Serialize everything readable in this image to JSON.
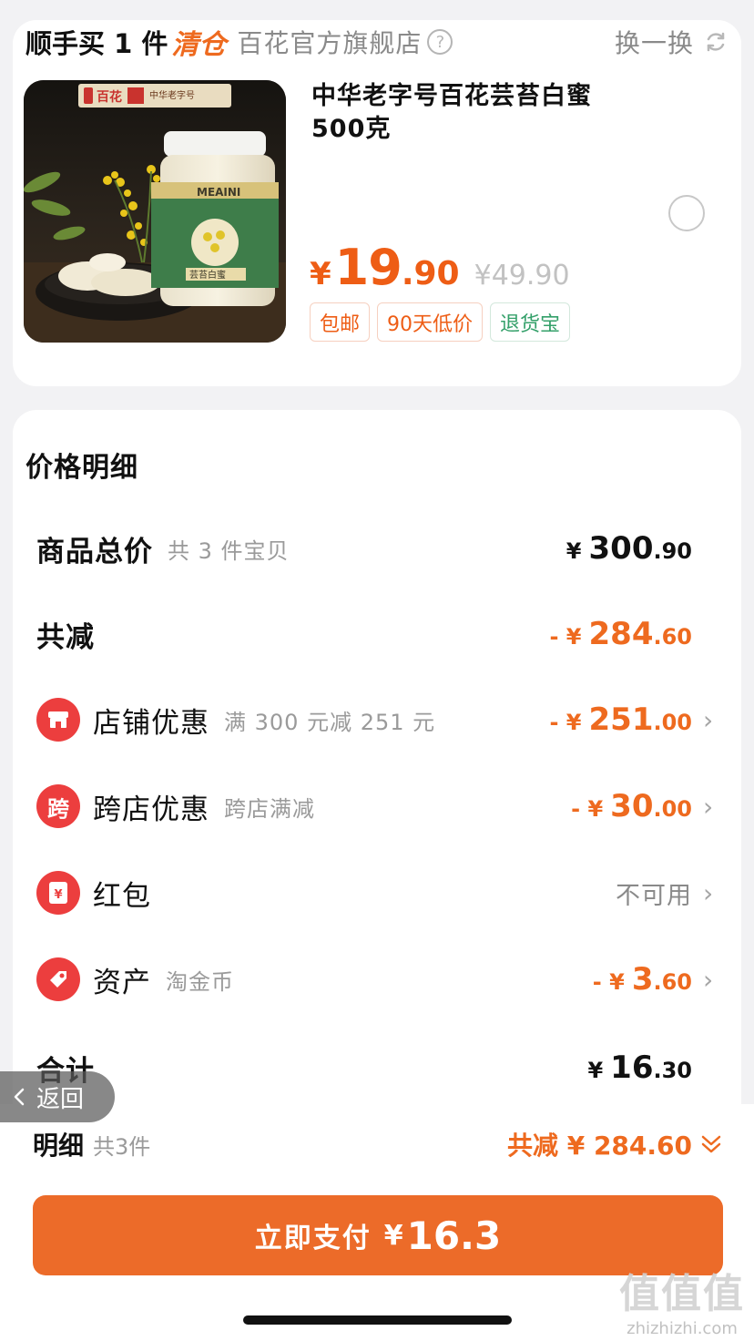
{
  "colors": {
    "accent": "#ee6a1f",
    "pay_button": "#ec6b29",
    "red_icon": "#ec3e3e",
    "green_tag": "#34a06a"
  },
  "top_card": {
    "title_main": "顺手买 1 件",
    "title_clear": "清仓",
    "store_name": "百花官方旗舰店",
    "help_icon": "?",
    "swap_label": "换一换",
    "product": {
      "brand_text": "百花",
      "brand_sub": "中华老字号",
      "jar_label": "MEAINI",
      "jar_sub": "芸苔白蜜",
      "name_line1": "中华老字号百花芸苔白蜜",
      "name_line2": "500克",
      "price_yen": "¥",
      "price_int": "19",
      "price_dec": ".90",
      "orig_price": "¥49.90",
      "tags": [
        "包邮",
        "90天低价",
        "退货宝"
      ]
    }
  },
  "detail": {
    "title": "价格明细",
    "total": {
      "label": "商品总价",
      "sub": "共 3 件宝贝",
      "yen": "¥",
      "int": "300",
      "dec": ".90"
    },
    "reduce": {
      "label": "共减",
      "prefix": "- ¥",
      "int": "284",
      "dec": ".60"
    },
    "shop_coupon": {
      "label": "店铺优惠",
      "sub": "满 300 元减 251 元",
      "prefix": "- ¥",
      "int": "251",
      "dec": ".00"
    },
    "cross_coupon": {
      "icon_char": "跨",
      "label": "跨店优惠",
      "sub": "跨店满减",
      "prefix": "- ¥",
      "int": "30",
      "dec": ".00"
    },
    "red_packet": {
      "icon_char": "¥",
      "label": "红包",
      "status": "不可用"
    },
    "asset": {
      "label": "资产",
      "sub": "淘金币",
      "prefix": "- ¥",
      "int": "3",
      "dec": ".60"
    },
    "sum": {
      "label": "合计",
      "yen": "¥",
      "int": "16",
      "dec": ".30"
    },
    "chevron": "›"
  },
  "back_label": "返回",
  "bottom": {
    "detail_label": "明细",
    "count_label": "共3件",
    "reduce_summary": "共减 ¥ 284.60",
    "pay_label": "立即支付",
    "pay_yen": "¥",
    "pay_amount": "16.3"
  },
  "watermark": {
    "big": "值值值",
    "small": "zhizhizhi.com"
  }
}
